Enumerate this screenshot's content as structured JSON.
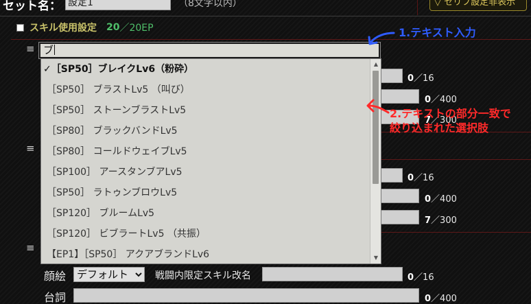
{
  "header": {
    "set_name_label": "セット名：",
    "set_name_value": "設定1",
    "set_name_hint": "（8文字以内）",
    "serifu_toggle": "▽ セリフ設定非表示"
  },
  "skill_setting": {
    "label": "スキル使用設定",
    "used": "20",
    "max": "／20EP"
  },
  "combobox": {
    "typed_text": "ブ",
    "options": [
      {
        "label": "✓［SP50］ブレイクLv6（粉砕）",
        "selected": true
      },
      {
        "label": "［SP50］ ブラストLv5 （叫び）",
        "selected": false
      },
      {
        "label": "［SP50］ ストーンブラストLv5",
        "selected": false
      },
      {
        "label": "［SP80］ ブラックバンドLv5",
        "selected": false
      },
      {
        "label": "［SP80］ コールドウェイブLv5",
        "selected": false
      },
      {
        "label": "［SP100］ アースタンブアLv5",
        "selected": false
      },
      {
        "label": "［SP50］ ラトゥンブロウLv5",
        "selected": false
      },
      {
        "label": "［SP120］ ブルームLv5",
        "selected": false
      },
      {
        "label": "［SP120］ ビブラートLv5 （共振）",
        "selected": false
      },
      {
        "label": "【EP1】［SP50］ アクアブランドLv6",
        "selected": false
      }
    ]
  },
  "annotations": {
    "step1": "1.テキスト入力",
    "step2_line1": "2.テキストの部分一致で",
    "step2_line2": "絞り込まれた選択肢"
  },
  "behind_rows": {
    "row1_name_count": "0",
    "row1_name_max": "／16",
    "row1_serif_count": "0",
    "row1_serif_max": "／400",
    "row1_extra_count": "7",
    "row1_extra_max": "／300",
    "row2_name_count": "0",
    "row2_name_max": "／16",
    "row2_serif_count": "0",
    "row2_serif_max": "／400",
    "row2_extra_count": "7",
    "row2_extra_max": "／300"
  },
  "bottom_row": {
    "face_label": "顔絵",
    "face_value": "デフォルト",
    "limited_name_label": "戦闘内限定スキル改名",
    "name_count": "0",
    "name_max": "／16",
    "serif_label": "台詞",
    "serif_count": "0",
    "serif_max": "／400"
  },
  "colors": {
    "accent_annotation_blue": "#2f5cff",
    "accent_annotation_red": "#ff2a2a",
    "skill_title": "#c9c26a",
    "ep_count_green": "#4fbf6a"
  }
}
